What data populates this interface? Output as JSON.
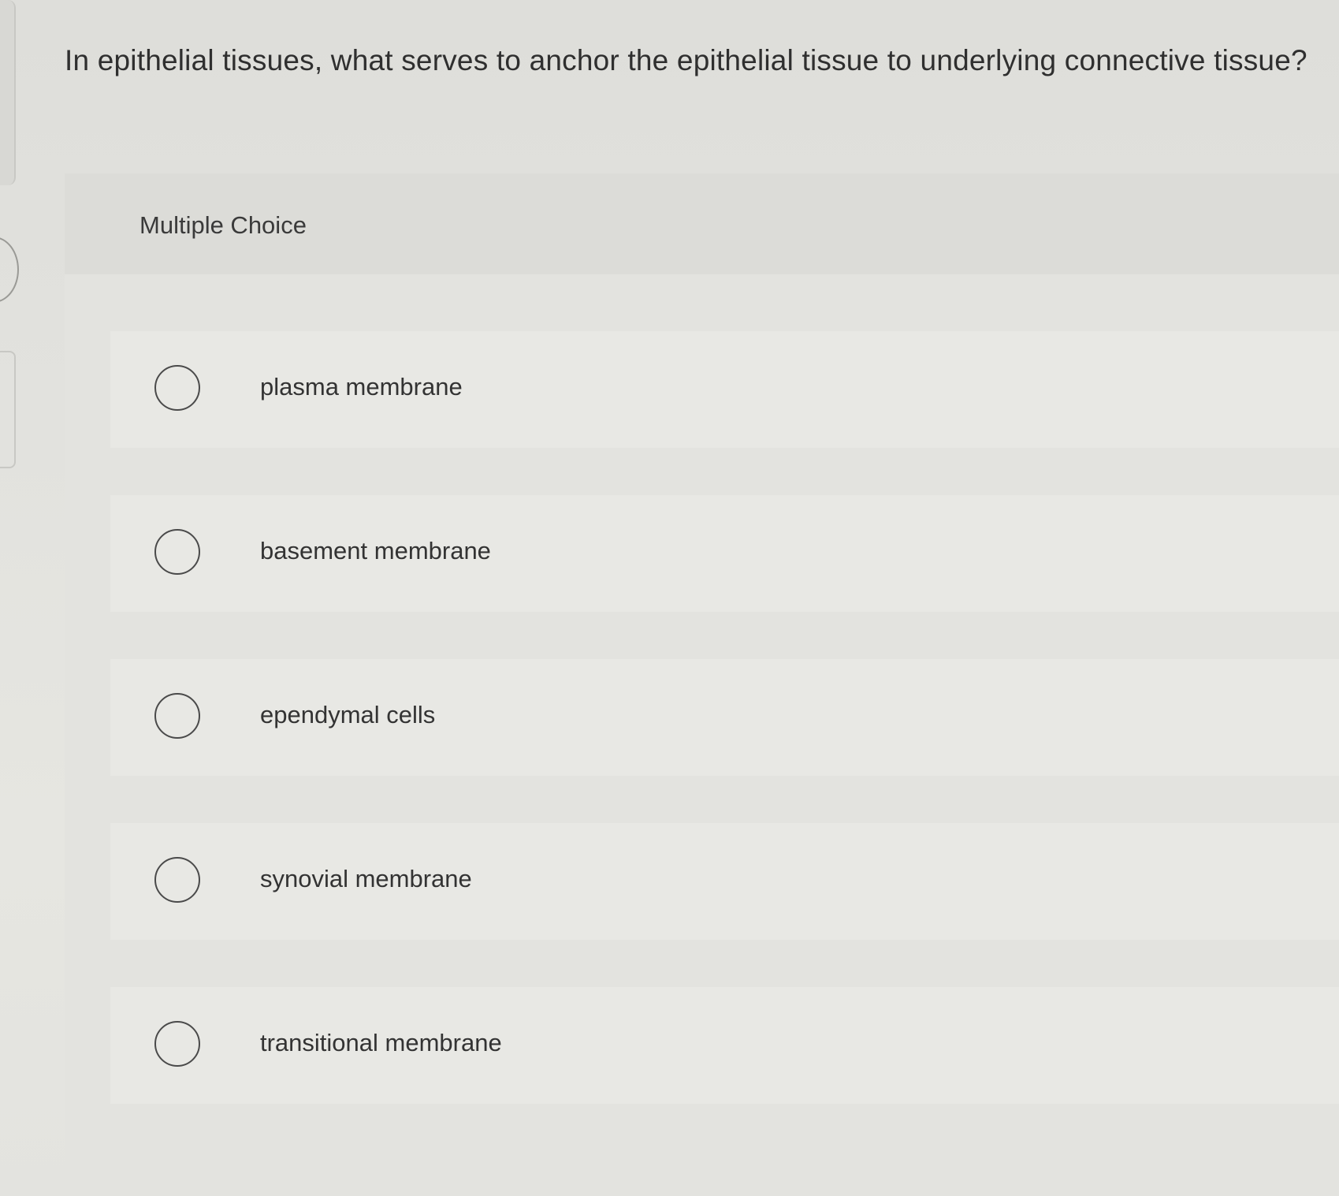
{
  "question": {
    "text": "In epithelial tissues, what serves to anchor the epithelial tissue to underlying connective tissue?"
  },
  "panel": {
    "title": "Multiple Choice"
  },
  "options": [
    {
      "label": "plasma membrane",
      "selected": false
    },
    {
      "label": "basement membrane",
      "selected": false
    },
    {
      "label": "ependymal cells",
      "selected": false
    },
    {
      "label": "synovial membrane",
      "selected": false
    },
    {
      "label": "transitional membrane",
      "selected": false
    }
  ],
  "colors": {
    "background": "#e3e3df",
    "text": "#2f2f2f",
    "radio_border": "#4a4a4a"
  }
}
